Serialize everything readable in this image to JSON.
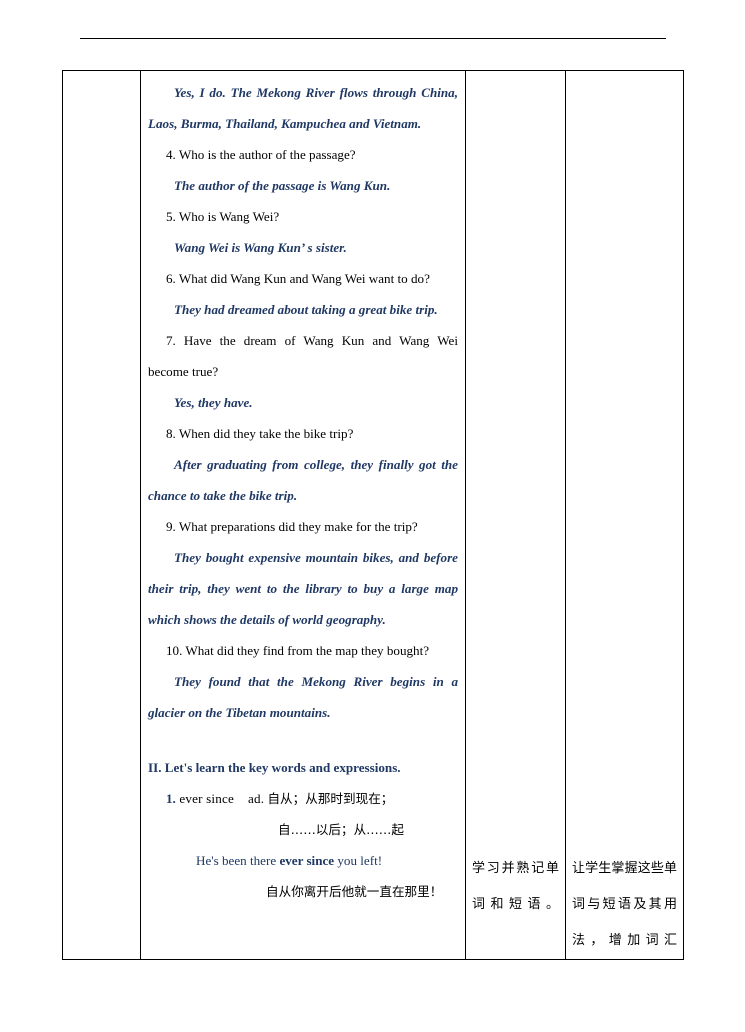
{
  "document": {
    "header_rule": true,
    "accent_color": "#1F3864",
    "text_color": "#000000"
  },
  "table": {
    "columns": [
      "procedure-step",
      "content",
      "purpose-note",
      "intent-note"
    ],
    "content_column": {
      "items": [
        {
          "type": "answer",
          "text": "Yes, I do. The Mekong River flows through China, Laos, Burma, Thailand, Kampuchea and Vietnam."
        },
        {
          "type": "question",
          "text": "4. Who is the author of the passage?"
        },
        {
          "type": "answer",
          "text": "The author of the passage is Wang Kun."
        },
        {
          "type": "question",
          "text": "5. Who is Wang Wei?"
        },
        {
          "type": "answer",
          "text": "Wang Wei is Wang Kun’ s sister."
        },
        {
          "type": "question",
          "text": "6. What did Wang Kun and Wang Wei want to do?"
        },
        {
          "type": "answer",
          "text": "They had dreamed about taking a great bike trip."
        },
        {
          "type": "question",
          "text": "7. Have the dream of Wang Kun and Wang Wei become true?"
        },
        {
          "type": "answer",
          "text": "Yes, they have."
        },
        {
          "type": "question",
          "text": "8. When did they take the bike trip?"
        },
        {
          "type": "answer",
          "text": "After graduating from college, they finally got the chance to take the bike trip."
        },
        {
          "type": "question",
          "text": "9. What preparations did they make for the trip?"
        },
        {
          "type": "answer",
          "text": "They bought expensive mountain bikes, and before their trip, they went to the library to buy a large map which shows the details of world geography."
        },
        {
          "type": "question",
          "text": "10. What did they find from the map they bought?"
        },
        {
          "type": "answer",
          "text": "They found that the Mekong River begins in a glacier on the Tibetan mountains."
        }
      ],
      "section_heading": "II. Let's learn the key words and expressions.",
      "vocabulary": {
        "number": "1.",
        "word": "ever since",
        "part_of_speech": "ad.",
        "meaning_line_1": "自从；从那时到现在；",
        "meaning_line_2": "自……以后；从……起",
        "example_prefix": "He's been there ",
        "example_highlight": "ever since",
        "example_suffix": " you left!",
        "example_translation": "自从你离开后他就一直在那里！"
      }
    },
    "purpose_note": "学习并熟记单词和短语。",
    "intent_note": "让学生掌握这些单词与短语及其用法，增加词汇"
  }
}
